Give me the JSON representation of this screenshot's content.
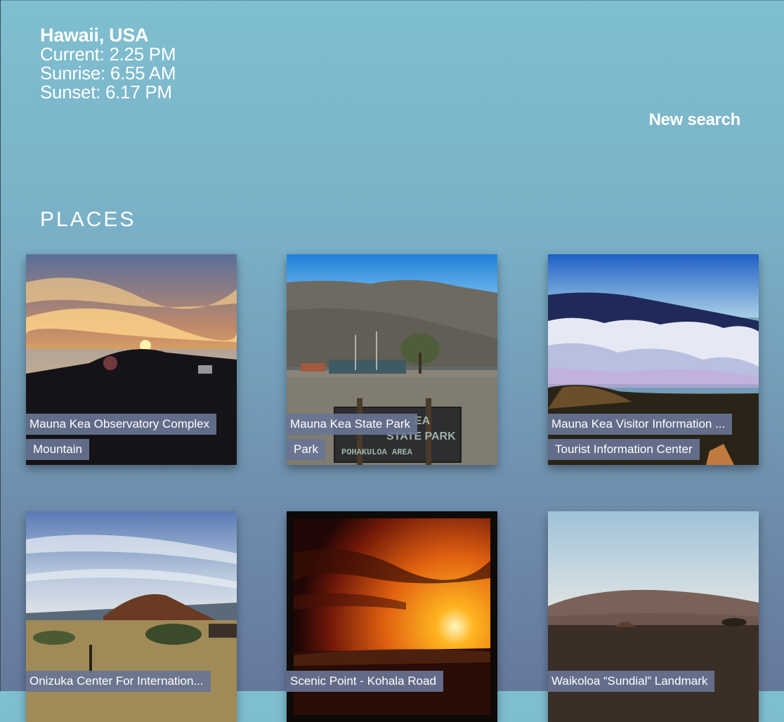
{
  "location": {
    "name": "Hawaii, USA",
    "current": "Current: 2.25 PM",
    "sunrise": "Sunrise: 6.55 AM",
    "sunset": "Sunset: 6.17 PM"
  },
  "actions": {
    "new_search": "New search"
  },
  "places_title": "PLACES",
  "places": [
    {
      "name": "Mauna Kea Observatory Complex",
      "type": "Mountain"
    },
    {
      "name": "Mauna Kea State Park",
      "type": "Park",
      "sign_line1": "EA",
      "sign_line2": "STATE PARK",
      "sign_line3": "POHAKULOA AREA"
    },
    {
      "name": "Mauna Kea Visitor Information ...",
      "type": "Tourist Information Center"
    },
    {
      "name": "Onizuka Center For Internation...",
      "type": ""
    },
    {
      "name": "Scenic Point - Kohala Road",
      "type": ""
    },
    {
      "name": "Waikoloa “Sundial” Landmark",
      "type": ""
    }
  ]
}
